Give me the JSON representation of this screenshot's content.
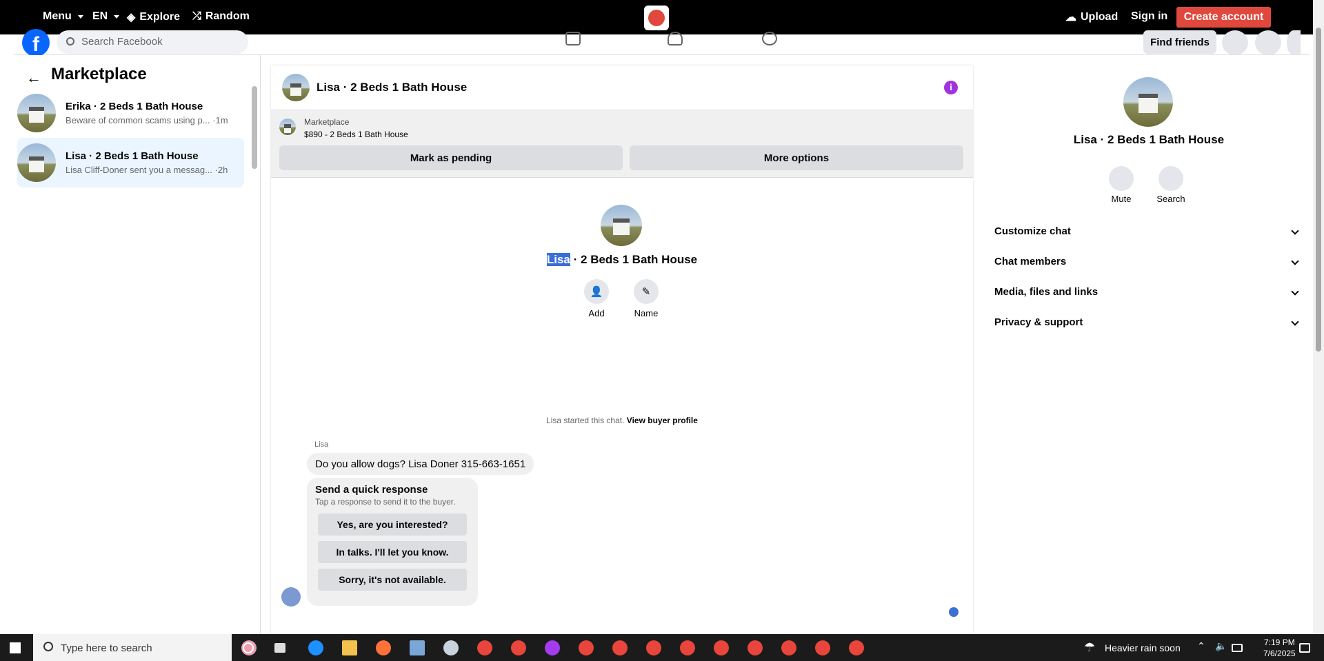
{
  "topbar": {
    "menu": "Menu",
    "lang": "EN",
    "explore": "Explore",
    "random": "Random",
    "upload": "Upload",
    "signin": "Sign in",
    "create_account": "Create account"
  },
  "fb": {
    "search_placeholder": "Search Facebook",
    "find_friends": "Find friends"
  },
  "sidebar": {
    "title": "Marketplace",
    "conversations": [
      {
        "name": "Erika · 2 Beds 1 Bath House",
        "preview": "Beware of common scams using p... ·1m"
      },
      {
        "name": "Lisa · 2 Beds 1 Bath House",
        "preview": "Lisa Cliff-Doner sent you a messag... ·2h"
      }
    ]
  },
  "chat": {
    "title": "Lisa · 2 Beds 1 Bath House",
    "listing_label": "Marketplace",
    "listing_price": "$890 - 2 Beds 1 Bath House",
    "mark_pending": "Mark as pending",
    "more_options": "More options",
    "center_title_hl": "Lisa",
    "center_title_rest": " · 2 Beds 1 Bath House",
    "add_label": "Add",
    "name_label": "Name",
    "started_text": "Lisa started this chat. ",
    "view_buyer": "View buyer profile",
    "sender": "Lisa",
    "message": "Do you allow dogs? Lisa Doner 315-663-1651",
    "quick_title": "Send a quick response",
    "quick_sub": "Tap a response to send it to the buyer.",
    "quick_options": [
      "Yes, are you interested?",
      "In talks. I'll let you know.",
      "Sorry, it's not available."
    ]
  },
  "details": {
    "title": "Lisa · 2 Beds 1 Bath House",
    "mute": "Mute",
    "search": "Search",
    "sections": [
      "Customize chat",
      "Chat members",
      "Media, files and links",
      "Privacy & support"
    ]
  },
  "taskbar": {
    "search_placeholder": "Type here to search",
    "weather": "Heavier rain soon",
    "time": "7:19 PM",
    "date": "7/6/2025"
  }
}
